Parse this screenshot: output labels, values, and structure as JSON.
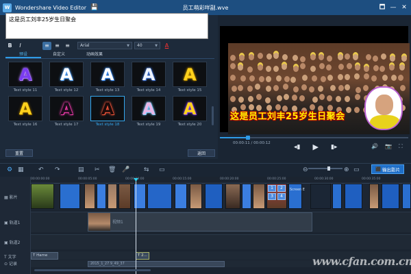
{
  "app": {
    "title": "Wondershare Video Editor",
    "logo_letter": "W",
    "project": "员工萌彩咩副.wve",
    "save_icon": "💾",
    "win_icons": [
      "🗖",
      "—",
      "✕"
    ]
  },
  "editor": {
    "text": "这是员工刘丰25岁生日聚会",
    "format": {
      "bold": "B",
      "italic": "I",
      "align": [
        "≡",
        "≡",
        "≡"
      ],
      "font": "Arial",
      "size": "40",
      "color_glyph": "A"
    },
    "tabs": [
      "预设",
      "自定义",
      "动画效果"
    ],
    "active_tab": 0,
    "styles": [
      {
        "label": "Text style 11",
        "color": "#7a3cf0",
        "glow": "#b07cff"
      },
      {
        "label": "Text style 12",
        "color": "#ffffff",
        "glow": "#59a8ff"
      },
      {
        "label": "Text style 13",
        "color": "#ffffff",
        "glow": "#3b8df5"
      },
      {
        "label": "Text style 14",
        "color": "#eef4ff",
        "glow": "#3b6fd0"
      },
      {
        "label": "Text style 15",
        "color": "#ffd21c",
        "glow": "#b98a00"
      },
      {
        "label": "Text style 16",
        "color": "#ffd21c",
        "glow": "#8a6400"
      },
      {
        "label": "Text style 17",
        "color": "#1a0d1a",
        "glow": "#ff3fb5"
      },
      {
        "label": "Text style 18",
        "color": "#1a0a0a",
        "glow": "#ff5a3c"
      },
      {
        "label": "Text style 19",
        "color": "#e8b7e6",
        "glow": "#7ad0ff"
      },
      {
        "label": "Text style 20",
        "color": "#ffd21c",
        "glow": "#7b3cf0"
      }
    ],
    "active_style": 7,
    "reset_button": "重置",
    "back_button": "返回"
  },
  "preview": {
    "caption": "这是员工刘丰25岁生日聚会",
    "time_current": "00:00:11",
    "time_total": "00:00:12",
    "progress": 0.15,
    "controls": {
      "prev": "◂▮",
      "play": "▶",
      "next": "▮▸"
    },
    "extra": [
      "🔊",
      "📷",
      "⛶"
    ]
  },
  "toolbar": {
    "icons": [
      "⚙",
      "▦",
      "↶",
      "↷",
      "▤",
      "✂",
      "🗑",
      "🎤",
      "⇆",
      "▭"
    ],
    "zoom_minus": "⊖",
    "zoom_plus": "⊕",
    "export": "输出影片",
    "zoom_level": 0.6
  },
  "timeline": {
    "tracks": [
      "影片",
      "轨道1",
      "轨道2",
      "文字",
      "记录"
    ],
    "track_icons": [
      "▦",
      "▣",
      "▣",
      "T",
      "⊙"
    ],
    "ruler": [
      "00:00:00:00",
      "00:00:05:00",
      "00:00:10:00",
      "00:00:15:00",
      "00:00:20:00",
      "00:00:25:00",
      "00:00:30:00",
      "00:00:35:00"
    ],
    "pip_label": "视频1",
    "text_clip1": "T Hame",
    "text_clip2": "T 2...",
    "record_clip": "2015_1_27 9_49_37",
    "screen_label": "Screen E",
    "numbers": [
      "1",
      "2",
      "3",
      "4"
    ]
  },
  "watermark": "www.cfan.com.cn"
}
